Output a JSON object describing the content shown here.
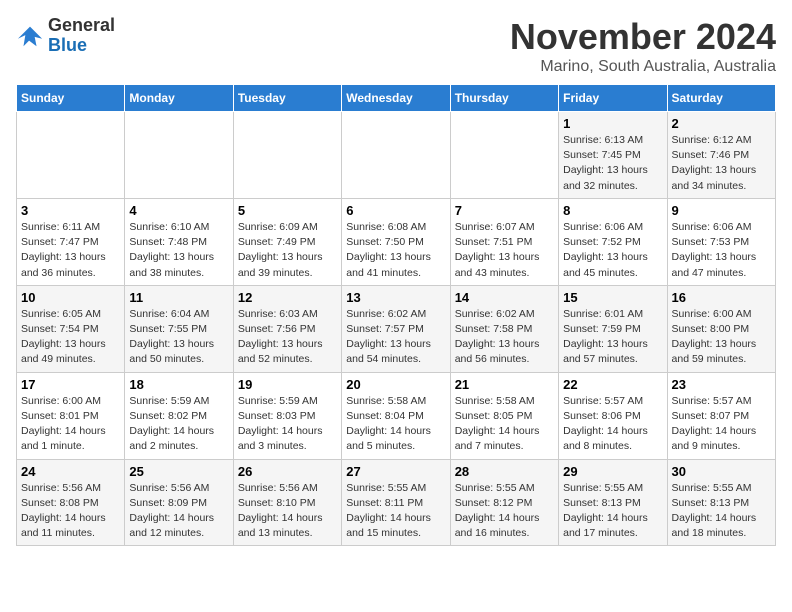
{
  "header": {
    "logo_general": "General",
    "logo_blue": "Blue",
    "month_year": "November 2024",
    "location": "Marino, South Australia, Australia"
  },
  "days_of_week": [
    "Sunday",
    "Monday",
    "Tuesday",
    "Wednesday",
    "Thursday",
    "Friday",
    "Saturday"
  ],
  "weeks": [
    [
      {
        "day": "",
        "info": ""
      },
      {
        "day": "",
        "info": ""
      },
      {
        "day": "",
        "info": ""
      },
      {
        "day": "",
        "info": ""
      },
      {
        "day": "",
        "info": ""
      },
      {
        "day": "1",
        "info": "Sunrise: 6:13 AM\nSunset: 7:45 PM\nDaylight: 13 hours and 32 minutes."
      },
      {
        "day": "2",
        "info": "Sunrise: 6:12 AM\nSunset: 7:46 PM\nDaylight: 13 hours and 34 minutes."
      }
    ],
    [
      {
        "day": "3",
        "info": "Sunrise: 6:11 AM\nSunset: 7:47 PM\nDaylight: 13 hours and 36 minutes."
      },
      {
        "day": "4",
        "info": "Sunrise: 6:10 AM\nSunset: 7:48 PM\nDaylight: 13 hours and 38 minutes."
      },
      {
        "day": "5",
        "info": "Sunrise: 6:09 AM\nSunset: 7:49 PM\nDaylight: 13 hours and 39 minutes."
      },
      {
        "day": "6",
        "info": "Sunrise: 6:08 AM\nSunset: 7:50 PM\nDaylight: 13 hours and 41 minutes."
      },
      {
        "day": "7",
        "info": "Sunrise: 6:07 AM\nSunset: 7:51 PM\nDaylight: 13 hours and 43 minutes."
      },
      {
        "day": "8",
        "info": "Sunrise: 6:06 AM\nSunset: 7:52 PM\nDaylight: 13 hours and 45 minutes."
      },
      {
        "day": "9",
        "info": "Sunrise: 6:06 AM\nSunset: 7:53 PM\nDaylight: 13 hours and 47 minutes."
      }
    ],
    [
      {
        "day": "10",
        "info": "Sunrise: 6:05 AM\nSunset: 7:54 PM\nDaylight: 13 hours and 49 minutes."
      },
      {
        "day": "11",
        "info": "Sunrise: 6:04 AM\nSunset: 7:55 PM\nDaylight: 13 hours and 50 minutes."
      },
      {
        "day": "12",
        "info": "Sunrise: 6:03 AM\nSunset: 7:56 PM\nDaylight: 13 hours and 52 minutes."
      },
      {
        "day": "13",
        "info": "Sunrise: 6:02 AM\nSunset: 7:57 PM\nDaylight: 13 hours and 54 minutes."
      },
      {
        "day": "14",
        "info": "Sunrise: 6:02 AM\nSunset: 7:58 PM\nDaylight: 13 hours and 56 minutes."
      },
      {
        "day": "15",
        "info": "Sunrise: 6:01 AM\nSunset: 7:59 PM\nDaylight: 13 hours and 57 minutes."
      },
      {
        "day": "16",
        "info": "Sunrise: 6:00 AM\nSunset: 8:00 PM\nDaylight: 13 hours and 59 minutes."
      }
    ],
    [
      {
        "day": "17",
        "info": "Sunrise: 6:00 AM\nSunset: 8:01 PM\nDaylight: 14 hours and 1 minute."
      },
      {
        "day": "18",
        "info": "Sunrise: 5:59 AM\nSunset: 8:02 PM\nDaylight: 14 hours and 2 minutes."
      },
      {
        "day": "19",
        "info": "Sunrise: 5:59 AM\nSunset: 8:03 PM\nDaylight: 14 hours and 3 minutes."
      },
      {
        "day": "20",
        "info": "Sunrise: 5:58 AM\nSunset: 8:04 PM\nDaylight: 14 hours and 5 minutes."
      },
      {
        "day": "21",
        "info": "Sunrise: 5:58 AM\nSunset: 8:05 PM\nDaylight: 14 hours and 7 minutes."
      },
      {
        "day": "22",
        "info": "Sunrise: 5:57 AM\nSunset: 8:06 PM\nDaylight: 14 hours and 8 minutes."
      },
      {
        "day": "23",
        "info": "Sunrise: 5:57 AM\nSunset: 8:07 PM\nDaylight: 14 hours and 9 minutes."
      }
    ],
    [
      {
        "day": "24",
        "info": "Sunrise: 5:56 AM\nSunset: 8:08 PM\nDaylight: 14 hours and 11 minutes."
      },
      {
        "day": "25",
        "info": "Sunrise: 5:56 AM\nSunset: 8:09 PM\nDaylight: 14 hours and 12 minutes."
      },
      {
        "day": "26",
        "info": "Sunrise: 5:56 AM\nSunset: 8:10 PM\nDaylight: 14 hours and 13 minutes."
      },
      {
        "day": "27",
        "info": "Sunrise: 5:55 AM\nSunset: 8:11 PM\nDaylight: 14 hours and 15 minutes."
      },
      {
        "day": "28",
        "info": "Sunrise: 5:55 AM\nSunset: 8:12 PM\nDaylight: 14 hours and 16 minutes."
      },
      {
        "day": "29",
        "info": "Sunrise: 5:55 AM\nSunset: 8:13 PM\nDaylight: 14 hours and 17 minutes."
      },
      {
        "day": "30",
        "info": "Sunrise: 5:55 AM\nSunset: 8:13 PM\nDaylight: 14 hours and 18 minutes."
      }
    ]
  ]
}
